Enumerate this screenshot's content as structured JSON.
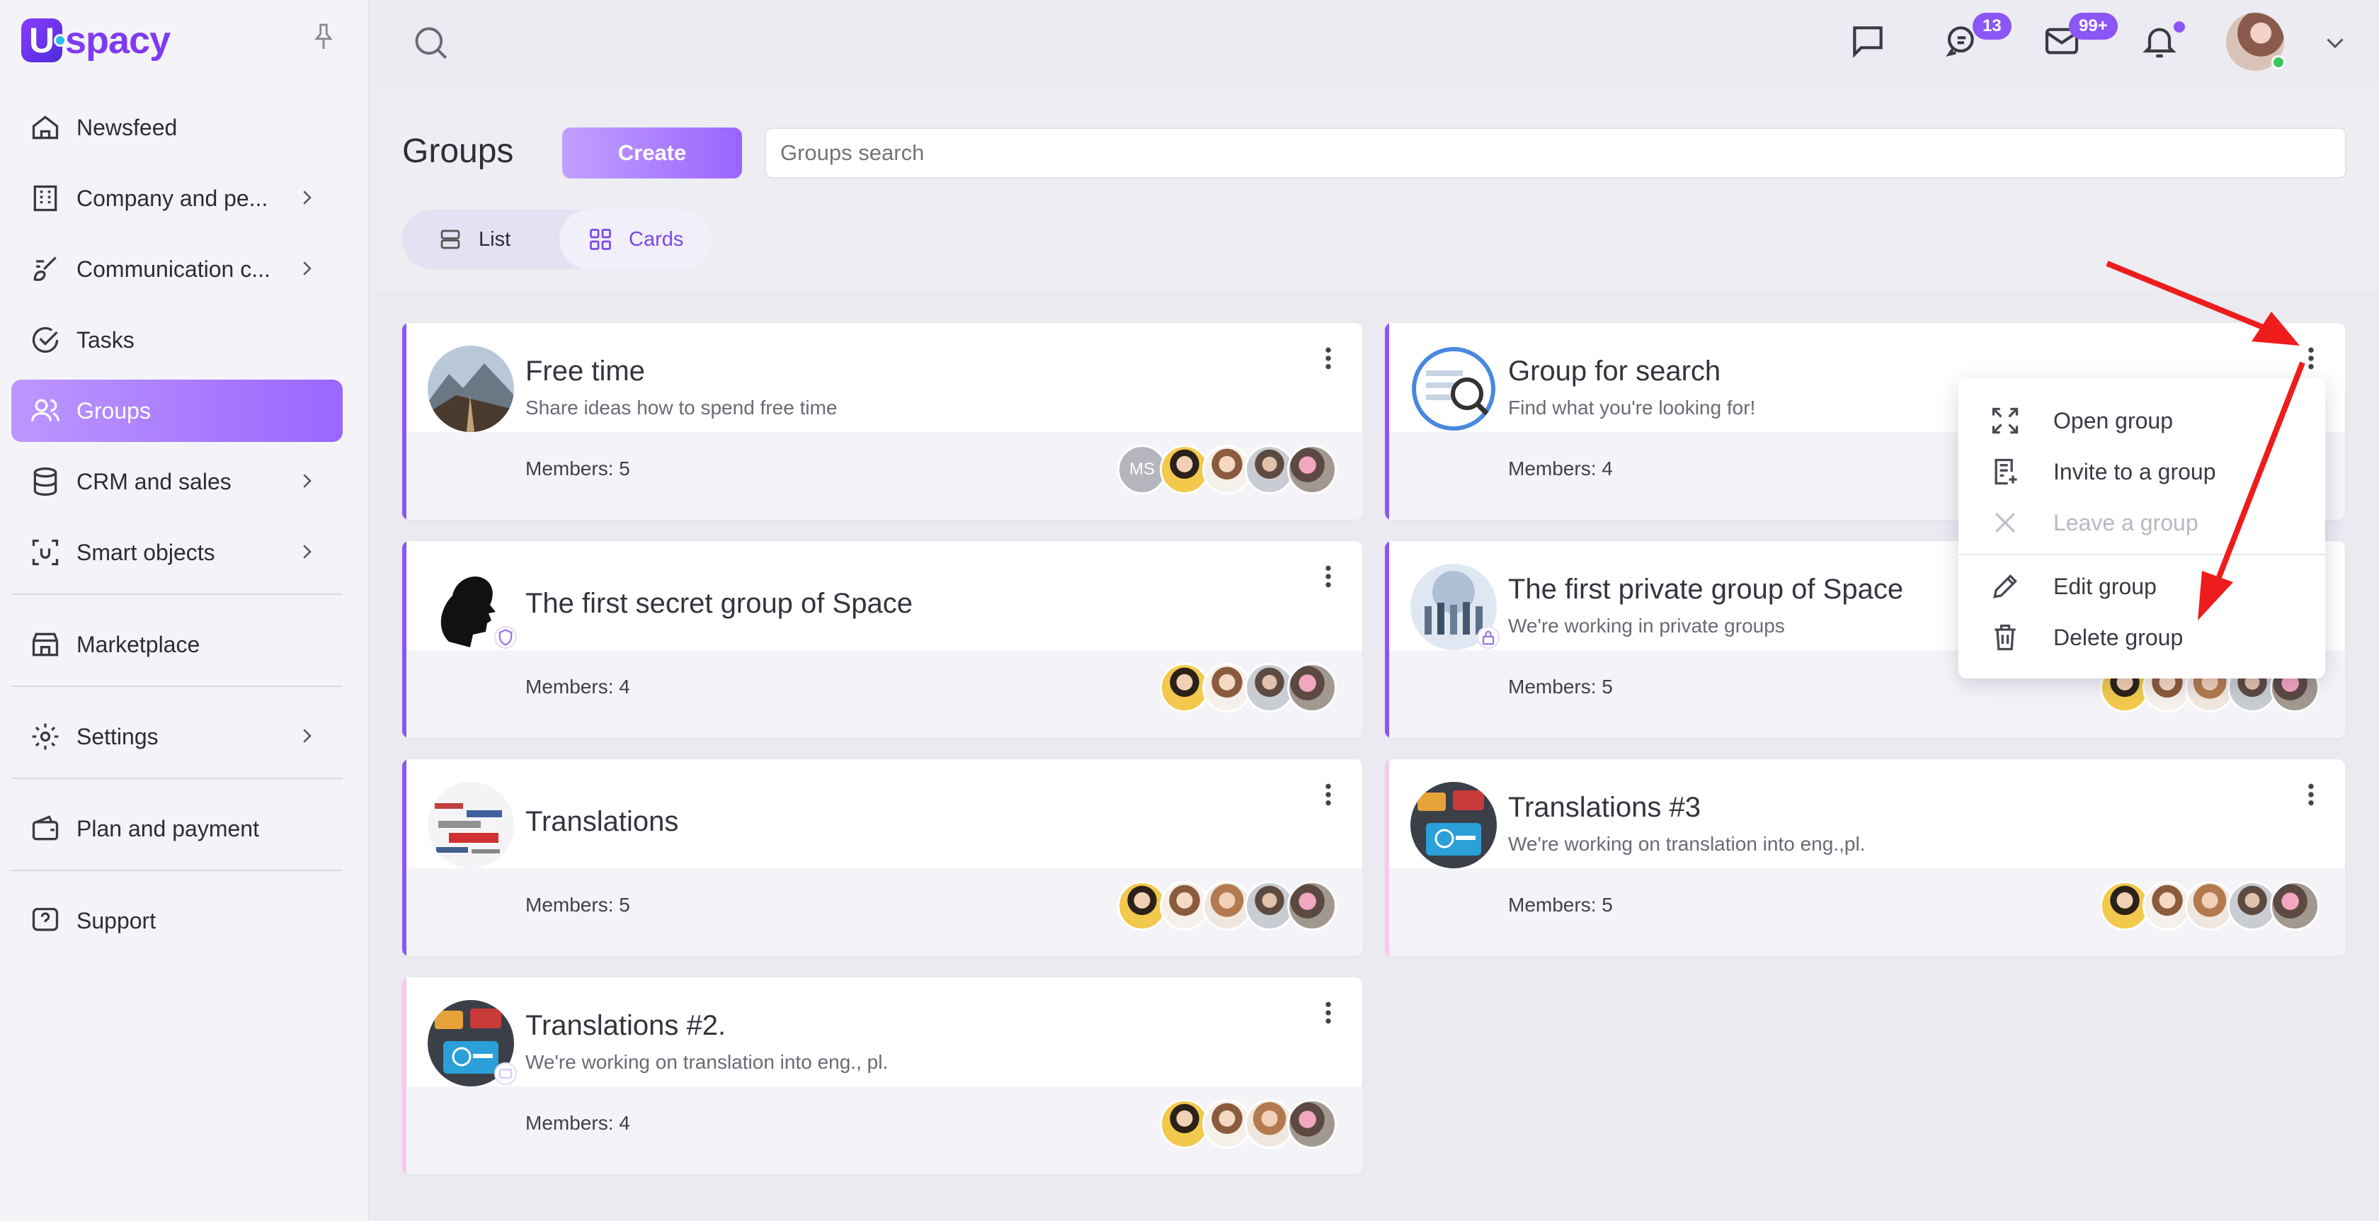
{
  "app": {
    "logo_letter": "U",
    "logo_word": "spacy"
  },
  "sidebar": {
    "items": [
      {
        "label": "Newsfeed",
        "icon": "home-icon",
        "has_children": false
      },
      {
        "label": "Company and pe...",
        "icon": "building-icon",
        "has_children": true
      },
      {
        "label": "Communication c...",
        "icon": "brush-icon",
        "has_children": true
      },
      {
        "label": "Tasks",
        "icon": "check-circle-icon",
        "has_children": false
      },
      {
        "label": "Groups",
        "icon": "users-icon",
        "has_children": false,
        "active": true
      },
      {
        "label": "CRM and sales",
        "icon": "database-icon",
        "has_children": true
      },
      {
        "label": "Smart objects",
        "icon": "smart-object-icon",
        "has_children": true
      },
      {
        "label": "Marketplace",
        "icon": "store-icon",
        "has_children": false
      },
      {
        "label": "Settings",
        "icon": "gear-icon",
        "has_children": true
      },
      {
        "label": "Plan and payment",
        "icon": "wallet-icon",
        "has_children": false
      },
      {
        "label": "Support",
        "icon": "question-icon",
        "has_children": false
      }
    ]
  },
  "topbar": {
    "chats_badge": "13",
    "mail_badge": "99+"
  },
  "header": {
    "title": "Groups",
    "create_label": "Create",
    "search_placeholder": "Groups search",
    "view_list": "List",
    "view_cards": "Cards"
  },
  "groups": [
    {
      "title": "Free time",
      "desc": "Share ideas how to spend free time",
      "members": "Members: 5",
      "initials": "MS"
    },
    {
      "title": "Group for search",
      "desc": "Find what you're looking for!",
      "members": "Members: 4"
    },
    {
      "title": "The first secret group of Space",
      "desc": "",
      "members": "Members: 4"
    },
    {
      "title": "The first private group of Space",
      "desc": "We're working in private groups",
      "members": "Members: 5"
    },
    {
      "title": "Translations",
      "desc": "",
      "members": "Members: 5"
    },
    {
      "title": "Translations #3",
      "desc": "We're working on translation into eng.,pl.",
      "members": "Members: 5"
    },
    {
      "title": "Translations #2.",
      "desc": "We're working on translation into eng., pl.",
      "members": "Members: 4"
    }
  ],
  "context_menu": {
    "items": [
      {
        "label": "Open group",
        "icon": "expand-icon",
        "enabled": true
      },
      {
        "label": "Invite to a group",
        "icon": "invite-doc-icon",
        "enabled": true
      },
      {
        "label": "Leave a group",
        "icon": "close-icon",
        "enabled": false
      },
      {
        "label": "Edit group",
        "icon": "pencil-icon",
        "enabled": true
      },
      {
        "label": "Delete group",
        "icon": "trash-icon",
        "enabled": true
      }
    ]
  },
  "colors": {
    "accent": "#8c55f5",
    "annotation_arrow": "#ee1c1c"
  }
}
